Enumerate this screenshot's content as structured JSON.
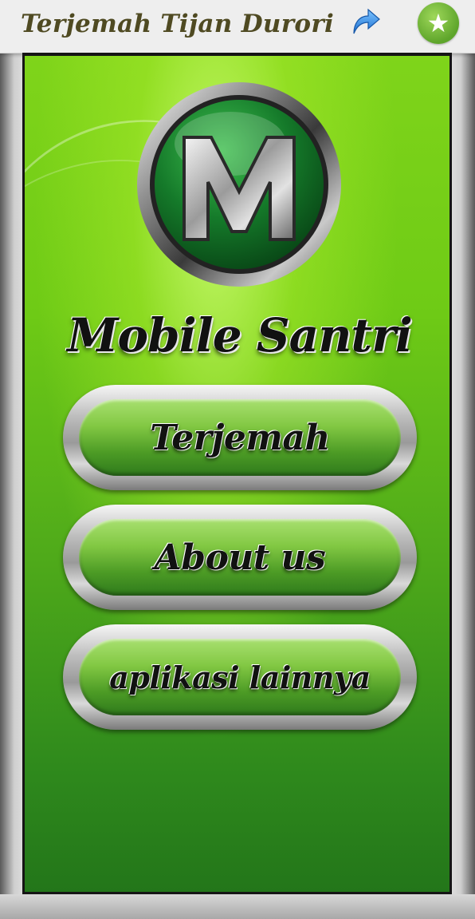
{
  "app_bar": {
    "title": "Terjemah Tijan Durori",
    "share_icon": "share-arrow-icon",
    "rate_icon": "star-icon",
    "rate_glyph": "★"
  },
  "splash": {
    "logo_letter": "M",
    "brand": "Mobile Santri"
  },
  "menu": {
    "items": [
      {
        "label": "Terjemah"
      },
      {
        "label": "About us"
      },
      {
        "label": "aplikasi lainnya"
      }
    ]
  },
  "colors": {
    "accent_green": "#6fcb16",
    "title_text": "#4f4a22",
    "star_button": "#5ea52b",
    "share_arrow": "#2e86de"
  }
}
